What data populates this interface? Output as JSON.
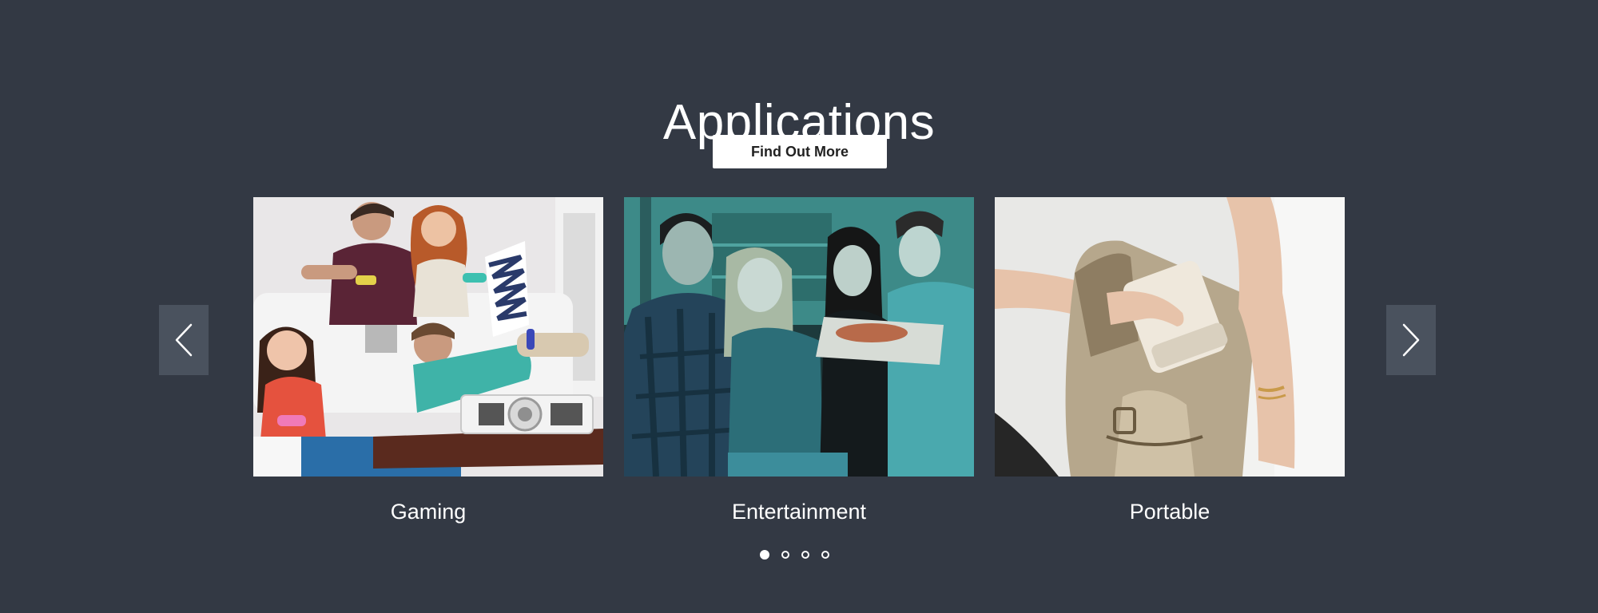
{
  "section": {
    "title": "Applications",
    "cta_label": "Find Out More"
  },
  "cards": [
    {
      "caption": "Gaming",
      "image": "friends-gaming-with-projector-photo"
    },
    {
      "caption": "Entertainment",
      "image": "friends-watching-and-eating-pizza-photo"
    },
    {
      "caption": "Portable",
      "image": "projector-in-handbag-photo"
    }
  ],
  "carousel": {
    "prev_icon": "chevron-left-icon",
    "next_icon": "chevron-right-icon",
    "page_count": 4,
    "active_page": 1
  },
  "colors": {
    "background": "#333944",
    "arrow_background": "#4a525e",
    "button_background": "#ffffff",
    "button_text": "#222222",
    "text": "#ffffff"
  }
}
